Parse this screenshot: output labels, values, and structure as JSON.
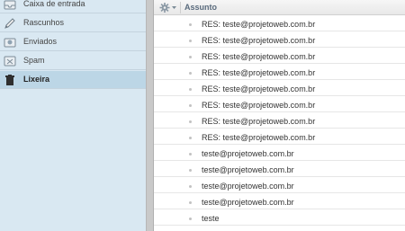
{
  "sidebar": {
    "folders": [
      {
        "label": "Caixa de entrada",
        "icon": "inbox-icon"
      },
      {
        "label": "Rascunhos",
        "icon": "pencil-icon"
      },
      {
        "label": "Enviados",
        "icon": "sent-icon"
      },
      {
        "label": "Spam",
        "icon": "spam-icon"
      },
      {
        "label": "Lixeira",
        "icon": "trash-icon"
      }
    ],
    "active_folder": "Lixeira"
  },
  "message_list": {
    "header": {
      "subject_label": "Assunto",
      "options_icon": "gear-icon"
    },
    "rows": [
      {
        "subject": "RES: teste@projetoweb.com.br"
      },
      {
        "subject": "RES: teste@projetoweb.com.br"
      },
      {
        "subject": "RES: teste@projetoweb.com.br"
      },
      {
        "subject": "RES: teste@projetoweb.com.br"
      },
      {
        "subject": "RES: teste@projetoweb.com.br"
      },
      {
        "subject": "RES: teste@projetoweb.com.br"
      },
      {
        "subject": "RES: teste@projetoweb.com.br"
      },
      {
        "subject": "RES: teste@projetoweb.com.br"
      },
      {
        "subject": "teste@projetoweb.com.br"
      },
      {
        "subject": "teste@projetoweb.com.br"
      },
      {
        "subject": "teste@projetoweb.com.br"
      },
      {
        "subject": "teste@projetoweb.com.br"
      },
      {
        "subject": "teste"
      }
    ]
  },
  "colors": {
    "sidebar_bg": "#d9e8f2",
    "active_folder_bg": "#bcd6e6",
    "header_text": "#5a6b7d"
  }
}
